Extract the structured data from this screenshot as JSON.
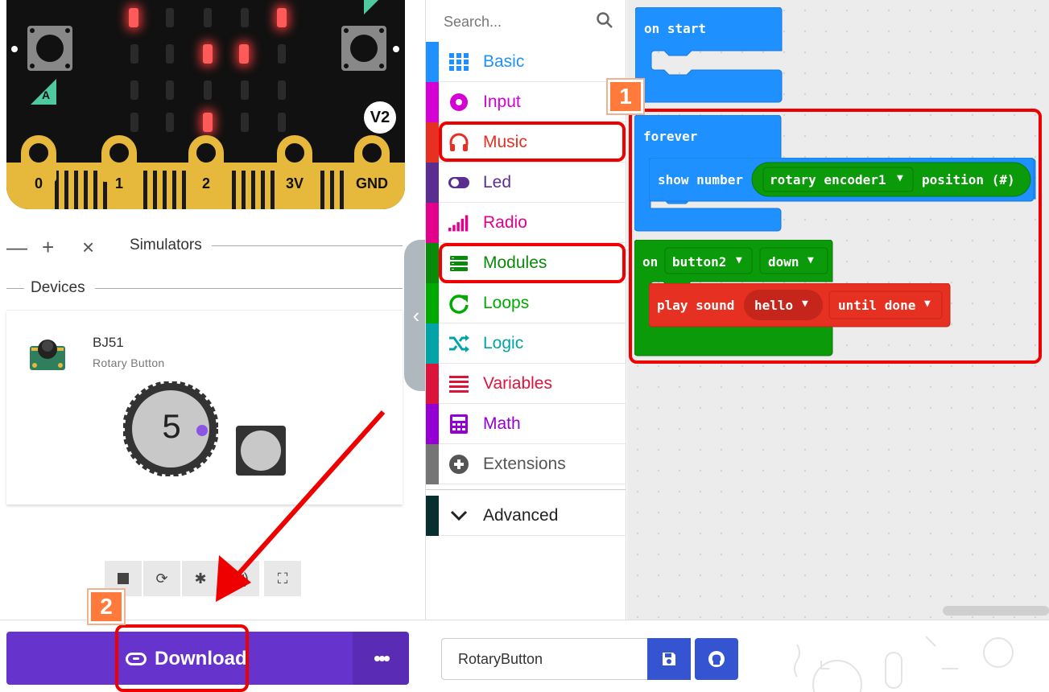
{
  "simulator": {
    "pin_labels": [
      "0",
      "1",
      "2",
      "3V",
      "GND"
    ],
    "board_version": "V2",
    "button_a_label": "A",
    "controls_label": "Simulators",
    "devices_label": "Devices",
    "device": {
      "name": "BJ51",
      "subtitle": "Rotary Button",
      "rotary_value": "5"
    }
  },
  "toolbox": {
    "search_placeholder": "Search...",
    "categories": [
      {
        "label": "Basic",
        "color": "#1e90ff",
        "icon": "grid-icon"
      },
      {
        "label": "Input",
        "color": "#d400d4",
        "icon": "target-icon"
      },
      {
        "label": "Music",
        "color": "#e63022",
        "icon": "headphones-icon"
      },
      {
        "label": "Led",
        "color": "#5c2d91",
        "icon": "toggle-icon"
      },
      {
        "label": "Radio",
        "color": "#e3008c",
        "icon": "signal-bars-icon"
      },
      {
        "label": "Modules",
        "color": "#0a8a0a",
        "icon": "stack-icon"
      },
      {
        "label": "Loops",
        "color": "#00aa00",
        "icon": "loop-icon"
      },
      {
        "label": "Logic",
        "color": "#00a4a6",
        "icon": "shuffle-icon"
      },
      {
        "label": "Variables",
        "color": "#dc143c",
        "icon": "list-icon"
      },
      {
        "label": "Math",
        "color": "#9400d3",
        "icon": "calculator-icon"
      },
      {
        "label": "Extensions",
        "color": "#757575",
        "icon": "plus-circle-icon"
      }
    ],
    "advanced_label": "Advanced"
  },
  "workspace": {
    "on_start": "on start",
    "forever": "forever",
    "show_number": "show number",
    "encoder_dropdown": "rotary encoder1",
    "position": "position (#)",
    "on_label": "on",
    "button_dropdown": "button2",
    "event_dropdown": "down",
    "play_sound": "play sound",
    "sound_dropdown": "hello",
    "mode_dropdown": "until done"
  },
  "bottom": {
    "download_label": "Download",
    "more_label": "•••",
    "project_name": "RotaryButton"
  },
  "annotations": {
    "badge1": "1",
    "badge2": "2"
  },
  "colors": {
    "download": "#6633cc",
    "blocks_blue": "#1e90ff",
    "blocks_green": "#0a9a0a",
    "blocks_red": "#e63022",
    "annotation_red": "#ee0000",
    "badge_orange": "#ff7a3b"
  }
}
